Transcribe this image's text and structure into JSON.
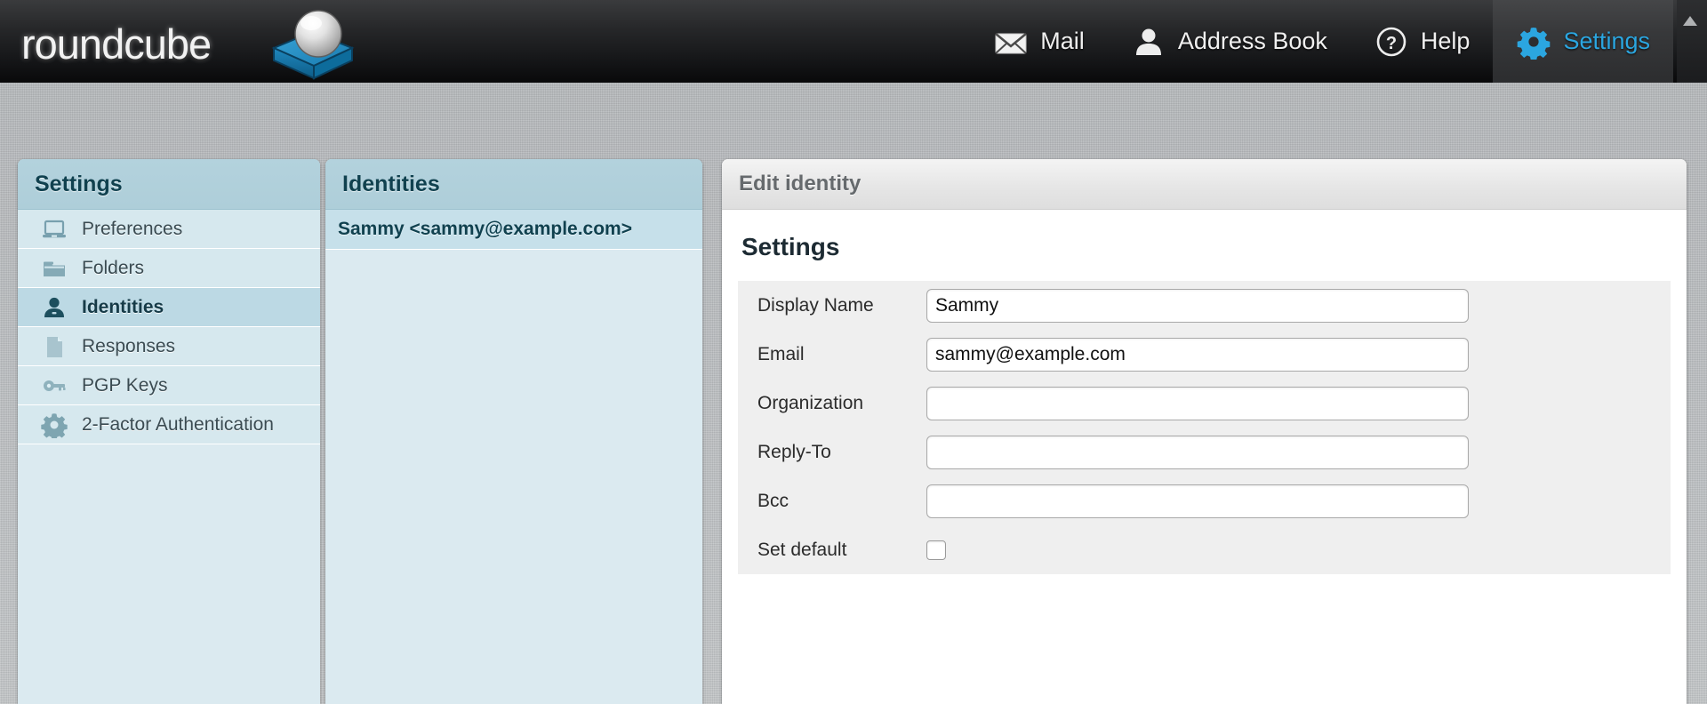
{
  "app": {
    "logo_text": "roundcube"
  },
  "taskbar": {
    "items": [
      {
        "label": "Mail",
        "icon": "envelope-icon",
        "selected": false
      },
      {
        "label": "Address Book",
        "icon": "person-icon",
        "selected": false
      },
      {
        "label": "Help",
        "icon": "question-circle-icon",
        "selected": false
      },
      {
        "label": "Settings",
        "icon": "gear-icon",
        "selected": true
      }
    ],
    "accent_color": "#2ba6e0"
  },
  "sidebar": {
    "title": "Settings",
    "items": [
      {
        "label": "Preferences",
        "icon": "laptop-icon",
        "selected": false
      },
      {
        "label": "Folders",
        "icon": "folder-icon",
        "selected": false
      },
      {
        "label": "Identities",
        "icon": "person-icon",
        "selected": true
      },
      {
        "label": "Responses",
        "icon": "document-icon",
        "selected": false
      },
      {
        "label": "PGP Keys",
        "icon": "key-icon",
        "selected": false
      },
      {
        "label": "2-Factor Authentication",
        "icon": "gear-icon",
        "selected": false
      }
    ]
  },
  "identities": {
    "title": "Identities",
    "rows": [
      {
        "label": "Sammy <sammy@example.com>",
        "selected": true
      }
    ]
  },
  "edit_identity": {
    "title": "Edit identity",
    "section_title": "Settings",
    "fields": [
      {
        "label": "Display Name",
        "value": "Sammy",
        "type": "text"
      },
      {
        "label": "Email",
        "value": "sammy@example.com",
        "type": "text"
      },
      {
        "label": "Organization",
        "value": "",
        "type": "text"
      },
      {
        "label": "Reply-To",
        "value": "",
        "type": "text"
      },
      {
        "label": "Bcc",
        "value": "",
        "type": "text"
      },
      {
        "label": "Set default",
        "value": "",
        "type": "checkbox",
        "checked": false
      }
    ]
  }
}
